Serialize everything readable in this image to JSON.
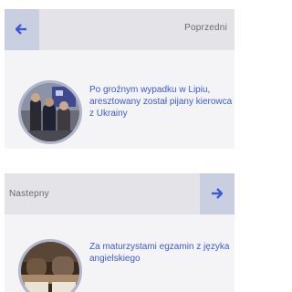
{
  "prev": {
    "label": "Poprzedni",
    "title": "Po groźnym wypadku w Lipiu, aresztowany został pijany kierowca z Ukrainy",
    "icon": "arrow-left-icon"
  },
  "next": {
    "label": "Nastepny",
    "title": "Za maturzystami egzamin z języka angielskiego",
    "icon": "arrow-right-icon"
  },
  "colors": {
    "accent": "#3b5bd6",
    "card_bg": "#f4f4f6",
    "header_bg": "#e3e3e8",
    "button_bg": "#c9cfe0",
    "thumb_border": "#b2b6cc"
  }
}
